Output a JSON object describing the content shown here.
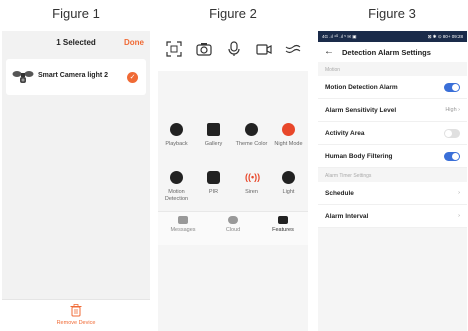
{
  "captions": [
    "Figure 1",
    "Figure 2",
    "Figure 3"
  ],
  "panel1": {
    "title": "1 Selected",
    "done_label": "Done",
    "device_name": "Smart Camera light 2",
    "device_icon": "camera-light-icon",
    "selected_icon": "check-icon",
    "footer_label": "Remove Device",
    "footer_icon": "trash-icon",
    "accent": "#f06a35"
  },
  "panel2": {
    "toolbar_icons": [
      "screenshot-icon",
      "camera-icon",
      "microphone-icon",
      "video-record-icon",
      "collapse-icon"
    ],
    "features": [
      {
        "label": "Playback",
        "icon": "playback-icon"
      },
      {
        "label": "Gallery",
        "icon": "gallery-icon"
      },
      {
        "label": "Theme Color",
        "icon": "theme-color-icon"
      },
      {
        "label": "Night Mode",
        "icon": "night-mode-icon"
      },
      {
        "label": "Motion Detection",
        "icon": "motion-detection-icon"
      },
      {
        "label": "PIR",
        "icon": "pir-icon"
      },
      {
        "label": "Siren",
        "icon": "siren-icon"
      },
      {
        "label": "Light",
        "icon": "light-icon"
      }
    ],
    "tabs": [
      {
        "label": "Messages",
        "icon": "messages-icon"
      },
      {
        "label": "Cloud",
        "icon": "cloud-icon"
      },
      {
        "label": "Features",
        "icon": "features-icon"
      }
    ]
  },
  "panel3": {
    "status_left": "4G .ıl ⁴ᴳ .ıl ⁵ ✉ ▣",
    "status_right": "⊠ ✱ ⊙ 80+ 09:28",
    "title": "Detection Alarm Settings",
    "section1": "Motion",
    "motion_alarm": "Motion Detection Alarm",
    "sensitivity_label": "Alarm Sensitivity Level",
    "sensitivity_value": "High",
    "activity_area": "Activity Area",
    "human_filter": "Human Body Filtering",
    "section2": "Alarm Timer Settings",
    "schedule": "Schedule",
    "alarm_interval": "Alarm Interval",
    "toggle_on_color": "#3a6fd8",
    "toggles": {
      "motion_alarm": true,
      "activity_area": false,
      "human_filter": true
    }
  }
}
